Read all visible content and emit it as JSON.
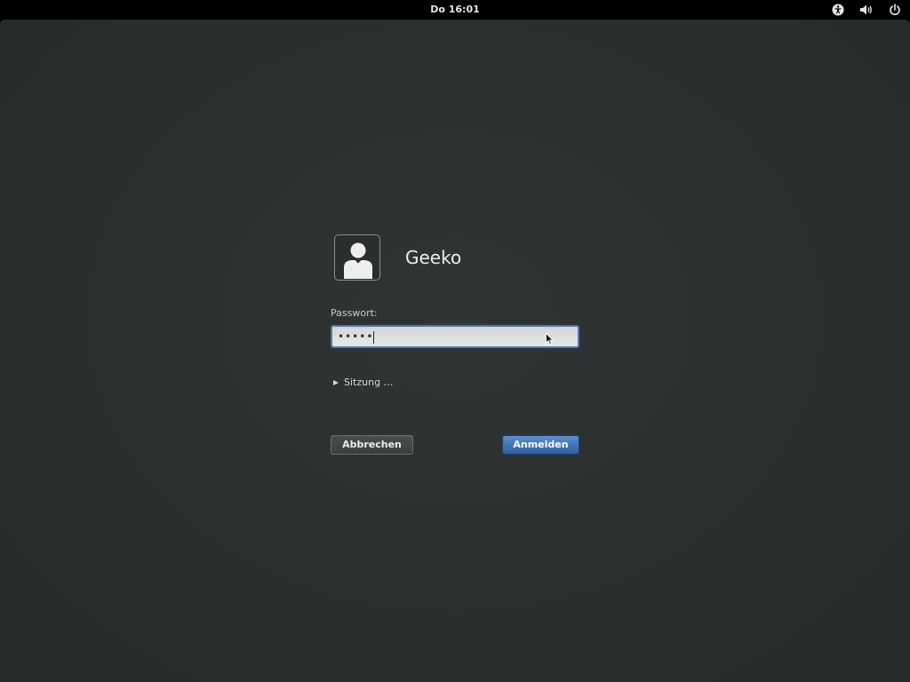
{
  "topbar": {
    "clock": "Do 16:01",
    "icons": [
      "accessibility-icon",
      "volume-icon",
      "power-icon"
    ]
  },
  "login": {
    "username": "Geeko",
    "password_label": "Passwort:",
    "password_value": "•••••",
    "session_label": "Sitzung …",
    "cancel_label": "Abbrechen",
    "login_label": "Anmelden"
  },
  "colors": {
    "background": "#2b302f",
    "topbar": "#000000",
    "accent": "#4a7bb5",
    "login_button": "#3b6cae"
  }
}
